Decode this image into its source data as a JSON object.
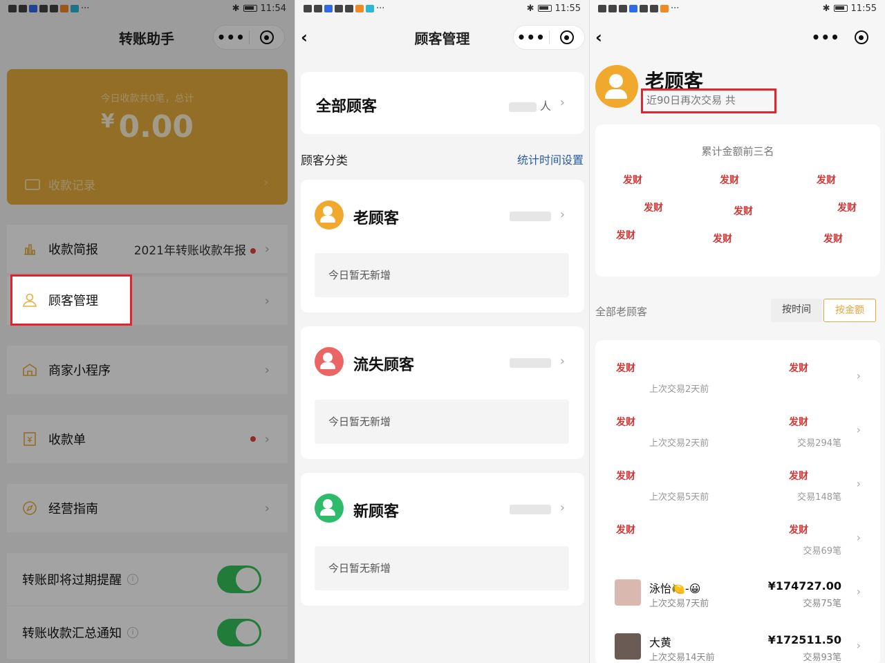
{
  "panel1": {
    "status_time": "11:54",
    "title": "转账助手",
    "summary": "今日收款共0笔，总计",
    "currency": "¥",
    "amount": "0.00",
    "records_label": "收款记录",
    "rows": {
      "report": {
        "label": "收款简报",
        "value": "2021年转账收款年报"
      },
      "customers": {
        "label": "顾客管理"
      },
      "merchant": {
        "label": "商家小程序"
      },
      "receipt": {
        "label": "收款单"
      },
      "guide": {
        "label": "经营指南"
      }
    },
    "toggles": {
      "expire": {
        "label": "转账即将过期提醒",
        "on": true
      },
      "summary": {
        "label": "转账收款汇总通知",
        "on": true
      }
    }
  },
  "panel2": {
    "status_time": "11:55",
    "title": "顾客管理",
    "all_customers": {
      "label": "全部顾客",
      "unit": "人"
    },
    "section_label": "顾客分类",
    "time_settings": "统计时间设置",
    "categories": [
      {
        "label": "老顾客",
        "note": "今日暂无新增"
      },
      {
        "label": "流失顾客",
        "note": "今日暂无新增"
      },
      {
        "label": "新顾客",
        "note": "今日暂无新增"
      }
    ]
  },
  "panel3": {
    "status_time": "11:55",
    "title": "老顾客",
    "subtitle": "近90日再次交易 共",
    "top3_label": "累计金额前三名",
    "list_label": "全部老顾客",
    "sort_time": "按时间",
    "sort_amount": "按金额",
    "stamp_text": "发财",
    "masked_rows": [
      {
        "last": "上次交易2天前",
        "tx": ""
      },
      {
        "last": "上次交易2天前",
        "tx": "交易294笔"
      },
      {
        "last": "上次交易5天前",
        "tx": "交易148笔"
      },
      {
        "last": "",
        "tx": "交易69笔"
      }
    ],
    "customers": [
      {
        "name": "泳怡🍋-😀",
        "last": "上次交易7天前",
        "amount": "¥174727.00",
        "tx": "交易75笔"
      },
      {
        "name": "大黄",
        "last": "上次交易14天前",
        "amount": "¥172511.50",
        "tx": "交易93笔"
      }
    ]
  },
  "colors": {
    "gold_card": "#e7ad3c",
    "toggle_on": "#34c05a",
    "highlight_box": "#e3232e",
    "link_blue": "#2a5ba8",
    "avatar_old": "#f0a92d",
    "avatar_lost": "#ec6565",
    "avatar_new": "#2ebc6c"
  }
}
